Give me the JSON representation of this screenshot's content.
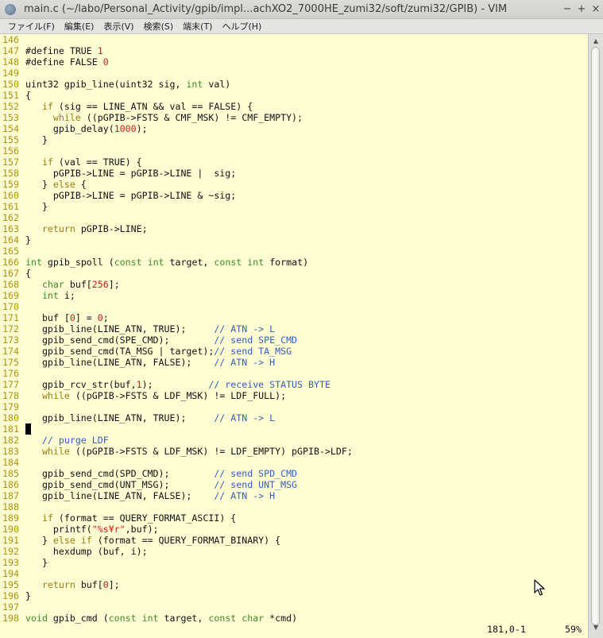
{
  "window": {
    "title": "main.c (~/labo/Personal_Activity/gpib/impl...achXO2_7000HE_zumi32/soft/zumi32/GPIB) - VIM",
    "buttons": {
      "close": "−",
      "minimize": "+",
      "maximize": "×"
    }
  },
  "menu": [
    {
      "label": "ファイル(F)"
    },
    {
      "label": "編集(E)"
    },
    {
      "label": "表示(V)"
    },
    {
      "label": "検索(S)"
    },
    {
      "label": "端末(T)"
    },
    {
      "label": "ヘルプ(H)"
    }
  ],
  "editor": {
    "lines": [
      {
        "n": "146",
        "t": []
      },
      {
        "n": "147",
        "t": [
          [
            "",
            "#define TRUE "
          ],
          [
            "num",
            "1"
          ]
        ]
      },
      {
        "n": "148",
        "t": [
          [
            "",
            "#define FALSE "
          ],
          [
            "num",
            "0"
          ]
        ]
      },
      {
        "n": "149",
        "t": []
      },
      {
        "n": "150",
        "t": [
          [
            "",
            "uint32 gpib_line(uint32 sig, "
          ],
          [
            "ty",
            "int"
          ],
          [
            "",
            " val)"
          ]
        ]
      },
      {
        "n": "151",
        "t": [
          [
            "",
            "{"
          ]
        ]
      },
      {
        "n": "152",
        "t": [
          [
            "",
            "   "
          ],
          [
            "kw",
            "if"
          ],
          [
            "",
            " (sig == LINE_ATN && val == FALSE) {"
          ]
        ]
      },
      {
        "n": "153",
        "t": [
          [
            "",
            "     "
          ],
          [
            "kw",
            "while"
          ],
          [
            "",
            " ((pGPIB->FSTS & CMF_MSK) != CMF_EMPTY);"
          ]
        ]
      },
      {
        "n": "154",
        "t": [
          [
            "",
            "     gpib_delay("
          ],
          [
            "num",
            "1000"
          ],
          [
            "",
            ");"
          ]
        ]
      },
      {
        "n": "155",
        "t": [
          [
            "",
            "   }"
          ]
        ]
      },
      {
        "n": "156",
        "t": []
      },
      {
        "n": "157",
        "t": [
          [
            "",
            "   "
          ],
          [
            "kw",
            "if"
          ],
          [
            "",
            " (val == TRUE) {"
          ]
        ]
      },
      {
        "n": "158",
        "t": [
          [
            "",
            "     pGPIB->LINE = pGPIB->LINE |  sig;"
          ]
        ]
      },
      {
        "n": "159",
        "t": [
          [
            "",
            "   } "
          ],
          [
            "kw",
            "else"
          ],
          [
            "",
            " {"
          ]
        ]
      },
      {
        "n": "160",
        "t": [
          [
            "",
            "     pGPIB->LINE = pGPIB->LINE & ~sig;"
          ]
        ]
      },
      {
        "n": "161",
        "t": [
          [
            "",
            "   }"
          ]
        ]
      },
      {
        "n": "162",
        "t": []
      },
      {
        "n": "163",
        "t": [
          [
            "",
            "   "
          ],
          [
            "kw",
            "return"
          ],
          [
            "",
            " pGPIB->LINE;"
          ]
        ]
      },
      {
        "n": "164",
        "t": [
          [
            "",
            "}"
          ]
        ]
      },
      {
        "n": "165",
        "t": []
      },
      {
        "n": "166",
        "t": [
          [
            "ty",
            "int"
          ],
          [
            "",
            " gpib_spoll ("
          ],
          [
            "ty",
            "const"
          ],
          [
            "",
            " "
          ],
          [
            "ty",
            "int"
          ],
          [
            "",
            " target, "
          ],
          [
            "ty",
            "const"
          ],
          [
            "",
            " "
          ],
          [
            "ty",
            "int"
          ],
          [
            "",
            " format)"
          ]
        ]
      },
      {
        "n": "167",
        "t": [
          [
            "",
            "{"
          ]
        ]
      },
      {
        "n": "168",
        "t": [
          [
            "",
            "   "
          ],
          [
            "ty",
            "char"
          ],
          [
            "",
            " buf["
          ],
          [
            "num",
            "256"
          ],
          [
            "",
            "];"
          ]
        ]
      },
      {
        "n": "169",
        "t": [
          [
            "",
            "   "
          ],
          [
            "ty",
            "int"
          ],
          [
            "",
            " i;"
          ]
        ]
      },
      {
        "n": "170",
        "t": []
      },
      {
        "n": "171",
        "t": [
          [
            "",
            "   buf ["
          ],
          [
            "num",
            "0"
          ],
          [
            "",
            "] = "
          ],
          [
            "num",
            "0"
          ],
          [
            "",
            ";"
          ]
        ]
      },
      {
        "n": "172",
        "t": [
          [
            "",
            "   gpib_line(LINE_ATN, TRUE);     "
          ],
          [
            "cm",
            "// ATN -> L"
          ]
        ]
      },
      {
        "n": "173",
        "t": [
          [
            "",
            "   gpib_send_cmd(SPE_CMD);        "
          ],
          [
            "cm",
            "// send SPE_CMD"
          ]
        ]
      },
      {
        "n": "174",
        "t": [
          [
            "",
            "   gpib_send_cmd(TA_MSG | target);"
          ],
          [
            "cm",
            "// send TA_MSG"
          ]
        ]
      },
      {
        "n": "175",
        "t": [
          [
            "",
            "   gpib_line(LINE_ATN, FALSE);    "
          ],
          [
            "cm",
            "// ATN -> H"
          ]
        ]
      },
      {
        "n": "176",
        "t": []
      },
      {
        "n": "177",
        "t": [
          [
            "",
            "   gpib_rcv_str(buf,"
          ],
          [
            "num",
            "1"
          ],
          [
            "",
            ");          "
          ],
          [
            "cm",
            "// receive STATUS BYTE"
          ]
        ]
      },
      {
        "n": "178",
        "t": [
          [
            "",
            "   "
          ],
          [
            "kw",
            "while"
          ],
          [
            "",
            " ((pGPIB->FSTS & LDF_MSK) != LDF_FULL);"
          ]
        ]
      },
      {
        "n": "179",
        "t": []
      },
      {
        "n": "180",
        "t": [
          [
            "",
            "   gpib_line(LINE_ATN, TRUE);     "
          ],
          [
            "cm",
            "// ATN -> L"
          ]
        ]
      },
      {
        "n": "181",
        "t": [
          [
            "cursor",
            " "
          ]
        ]
      },
      {
        "n": "182",
        "t": [
          [
            "",
            "   "
          ],
          [
            "cm",
            "// purge LDF"
          ]
        ]
      },
      {
        "n": "183",
        "t": [
          [
            "",
            "   "
          ],
          [
            "kw",
            "while"
          ],
          [
            "",
            " ((pGPIB->FSTS & LDF_MSK) != LDF_EMPTY) pGPIB->LDF;"
          ]
        ]
      },
      {
        "n": "184",
        "t": []
      },
      {
        "n": "185",
        "t": [
          [
            "",
            "   gpib_send_cmd(SPD_CMD);        "
          ],
          [
            "cm",
            "// send SPD_CMD"
          ]
        ]
      },
      {
        "n": "186",
        "t": [
          [
            "",
            "   gpib_send_cmd(UNT_MSG);        "
          ],
          [
            "cm",
            "// send UNT_MSG"
          ]
        ]
      },
      {
        "n": "187",
        "t": [
          [
            "",
            "   gpib_line(LINE_ATN, FALSE);    "
          ],
          [
            "cm",
            "// ATN -> H"
          ]
        ]
      },
      {
        "n": "188",
        "t": []
      },
      {
        "n": "189",
        "t": [
          [
            "",
            "   "
          ],
          [
            "kw",
            "if"
          ],
          [
            "",
            " (format == QUERY_FORMAT_ASCII) {"
          ]
        ]
      },
      {
        "n": "190",
        "t": [
          [
            "",
            "     printf("
          ],
          [
            "num",
            "\"%s¥r\""
          ],
          [
            "",
            ",buf);"
          ]
        ]
      },
      {
        "n": "191",
        "t": [
          [
            "",
            "   } "
          ],
          [
            "kw",
            "else if"
          ],
          [
            "",
            " (format == QUERY_FORMAT_BINARY) {"
          ]
        ]
      },
      {
        "n": "192",
        "t": [
          [
            "",
            "     hexdump (buf, i);"
          ]
        ]
      },
      {
        "n": "193",
        "t": [
          [
            "",
            "   }"
          ]
        ]
      },
      {
        "n": "194",
        "t": []
      },
      {
        "n": "195",
        "t": [
          [
            "",
            "   "
          ],
          [
            "kw",
            "return"
          ],
          [
            "",
            " buf["
          ],
          [
            "num",
            "0"
          ],
          [
            "",
            "];"
          ]
        ]
      },
      {
        "n": "196",
        "t": [
          [
            "",
            "}"
          ]
        ]
      },
      {
        "n": "197",
        "t": []
      },
      {
        "n": "198",
        "t": [
          [
            "ty",
            "void"
          ],
          [
            "",
            " gpib_cmd ("
          ],
          [
            "ty",
            "const"
          ],
          [
            "",
            " "
          ],
          [
            "ty",
            "int"
          ],
          [
            "",
            " target, "
          ],
          [
            "ty",
            "const"
          ],
          [
            "",
            " "
          ],
          [
            "ty",
            "char"
          ],
          [
            "",
            " *cmd)"
          ]
        ]
      }
    ],
    "status": {
      "cursor_position": "181,0-1",
      "scroll_percent": "59%"
    }
  },
  "scrollbar": {
    "up_arrow": "▲",
    "down_arrow": "▼"
  }
}
